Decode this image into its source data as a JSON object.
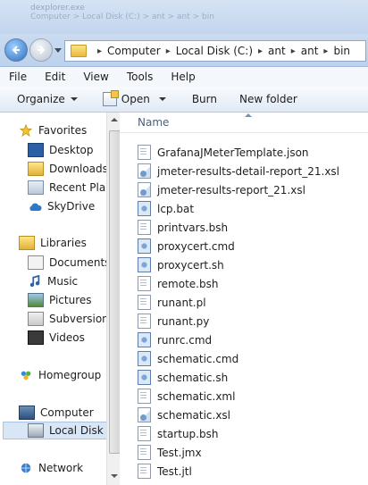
{
  "window": {
    "ghost_title": "dexplorer.exe",
    "ghost_subtitle": "Computer > Local Disk (C:) > ant > ant > bin"
  },
  "address": {
    "crumbs": [
      "Computer",
      "Local Disk (C:)",
      "ant",
      "ant",
      "bin"
    ]
  },
  "menu": [
    "File",
    "Edit",
    "View",
    "Tools",
    "Help"
  ],
  "toolbar": {
    "organize": "Organize",
    "open": "Open",
    "burn": "Burn",
    "new_folder": "New folder"
  },
  "nav": {
    "favorites": "Favorites",
    "desktop": "Desktop",
    "downloads": "Downloads",
    "recent": "Recent Place",
    "skydrive": "SkyDrive",
    "libraries": "Libraries",
    "documents": "Documents",
    "music": "Music",
    "pictures": "Pictures",
    "subversion": "Subversion",
    "videos": "Videos",
    "homegroup": "Homegroup",
    "computer": "Computer",
    "localdisk": "Local Disk (C",
    "network": "Network"
  },
  "files": {
    "header": "Name",
    "items": [
      {
        "name": "GrafanaJMeterTemplate.json",
        "icon": "document-icon"
      },
      {
        "name": "jmeter-results-detail-report_21.xsl",
        "icon": "xsl-file-icon"
      },
      {
        "name": "jmeter-results-report_21.xsl",
        "icon": "xsl-file-icon"
      },
      {
        "name": "lcp.bat",
        "icon": "script-gear-icon"
      },
      {
        "name": "printvars.bsh",
        "icon": "document-icon"
      },
      {
        "name": "proxycert.cmd",
        "icon": "script-gear-icon"
      },
      {
        "name": "proxycert.sh",
        "icon": "script-gear-icon"
      },
      {
        "name": "remote.bsh",
        "icon": "document-icon"
      },
      {
        "name": "runant.pl",
        "icon": "document-icon"
      },
      {
        "name": "runant.py",
        "icon": "document-icon"
      },
      {
        "name": "runrc.cmd",
        "icon": "script-gear-icon"
      },
      {
        "name": "schematic.cmd",
        "icon": "script-gear-icon"
      },
      {
        "name": "schematic.sh",
        "icon": "script-gear-icon"
      },
      {
        "name": "schematic.xml",
        "icon": "document-icon"
      },
      {
        "name": "schematic.xsl",
        "icon": "xsl-file-icon"
      },
      {
        "name": "startup.bsh",
        "icon": "document-icon"
      },
      {
        "name": "Test.jmx",
        "icon": "document-icon"
      },
      {
        "name": "Test.jtl",
        "icon": "document-icon"
      }
    ]
  }
}
